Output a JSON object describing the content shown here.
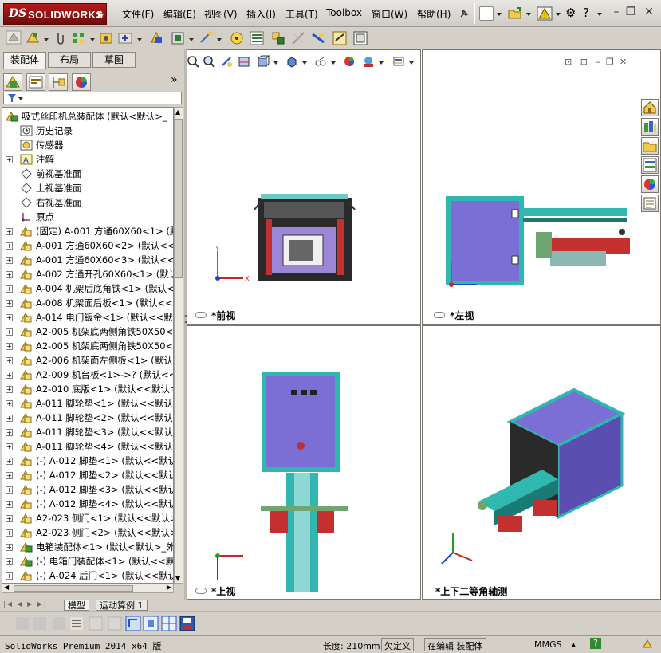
{
  "app": {
    "logo_ds": "DS",
    "logo_name": "SOLIDWORKS",
    "menus": [
      "文件(F)",
      "编辑(E)",
      "视图(V)",
      "插入(I)",
      "工具(T)",
      "Toolbox",
      "窗口(W)",
      "帮助(H)"
    ]
  },
  "left_panel": {
    "tabs": [
      "装配体",
      "布局",
      "草图"
    ],
    "root": "吸式丝印机总装配体  (默认<默认>_",
    "items": [
      {
        "label": "历史记录",
        "icon": "history-icon",
        "expand": false
      },
      {
        "label": "传感器",
        "icon": "sensor-icon",
        "expand": false
      },
      {
        "label": "注解",
        "icon": "annotation-icon",
        "expand": true
      },
      {
        "label": "前视基准面",
        "icon": "plane-icon",
        "expand": false
      },
      {
        "label": "上视基准面",
        "icon": "plane-icon",
        "expand": false
      },
      {
        "label": "右视基准面",
        "icon": "plane-icon",
        "expand": false
      },
      {
        "label": "原点",
        "icon": "origin-icon",
        "expand": false
      },
      {
        "label": "(固定) A-001 方通60X60<1> (默",
        "icon": "part-icon",
        "expand": true
      },
      {
        "label": "A-001 方通60X60<2> (默认<<默认",
        "icon": "part-icon",
        "expand": true
      },
      {
        "label": "A-001 方通60X60<3> (默认<<默认",
        "icon": "part-icon",
        "expand": true
      },
      {
        "label": "A-002 方通开孔60X60<1> (默认<",
        "icon": "part-icon",
        "expand": true
      },
      {
        "label": "A-004 机架后底角铁<1> (默认<<",
        "icon": "part-icon",
        "expand": true
      },
      {
        "label": "A-008 机架面后板<1> (默认<<默",
        "icon": "part-icon",
        "expand": true
      },
      {
        "label": "A-014 电门钣金<1> (默认<<默认",
        "icon": "part-icon",
        "expand": true
      },
      {
        "label": "A2-005 机架底两侧角铁50X50<1>",
        "icon": "part-icon",
        "expand": true
      },
      {
        "label": "A2-005 机架底两侧角铁50X50<2>",
        "icon": "part-icon",
        "expand": true
      },
      {
        "label": "A2-006 机架面左侧板<1> (默认<",
        "icon": "part-icon",
        "expand": true
      },
      {
        "label": "A2-009 机台板<1>->? (默认<<默",
        "icon": "part-icon",
        "expand": true
      },
      {
        "label": "A2-010 底版<1> (默认<<默认>_显",
        "icon": "part-icon",
        "expand": true
      },
      {
        "label": "A-011 脚轮垫<1> (默认<<默认>_",
        "icon": "part-icon",
        "expand": true
      },
      {
        "label": "A-011 脚轮垫<2> (默认<<默认>_",
        "icon": "part-icon",
        "expand": true
      },
      {
        "label": "A-011 脚轮垫<3> (默认<<默认>_",
        "icon": "part-icon",
        "expand": true
      },
      {
        "label": "A-011 脚轮垫<4> (默认<<默认>_",
        "icon": "part-icon",
        "expand": true
      },
      {
        "label": "(-) A-012 脚垫<1> (默认<<默认",
        "icon": "part-icon",
        "expand": true
      },
      {
        "label": "(-) A-012 脚垫<2> (默认<<默认",
        "icon": "part-icon",
        "expand": true
      },
      {
        "label": "(-) A-012 脚垫<3> (默认<<默认",
        "icon": "part-icon",
        "expand": true
      },
      {
        "label": "(-) A-012 脚垫<4> (默认<<默认",
        "icon": "part-icon",
        "expand": true
      },
      {
        "label": "A2-023 侧门<1> (默认<<默认>_显",
        "icon": "part-icon",
        "expand": true
      },
      {
        "label": "A2-023 侧门<2> (默认<<默认>_显",
        "icon": "part-icon",
        "expand": true
      },
      {
        "label": "电箱装配体<1> (默认<默认>_外",
        "icon": "assembly-icon",
        "expand": true
      },
      {
        "label": "(-) 电箱门装配体<1> (默认<<默",
        "icon": "assembly-icon",
        "expand": true
      },
      {
        "label": "(-) A-024 后门<1> (默认<<默认",
        "icon": "part-icon",
        "expand": true
      }
    ]
  },
  "viewports": {
    "front": "*前视",
    "left": "*左视",
    "top": "*上视",
    "iso": "*上下二等角轴测"
  },
  "model_tabs": [
    "模型",
    "运动算例 1"
  ],
  "status": {
    "app_version": "SolidWorks Premium 2014 x64 版",
    "length": "长度: 210mm",
    "defined": "欠定义",
    "editing": "在编辑 装配体",
    "units": "MMGS",
    "units_arrow": "▲",
    "help": "?"
  },
  "colors": {
    "brand_red": "#b81a1a",
    "teal": "#2fb7b0",
    "purple_panel": "#7b6fd6",
    "axis_x": "#d42020",
    "axis_y": "#20a020",
    "axis_z": "#2040d0"
  }
}
